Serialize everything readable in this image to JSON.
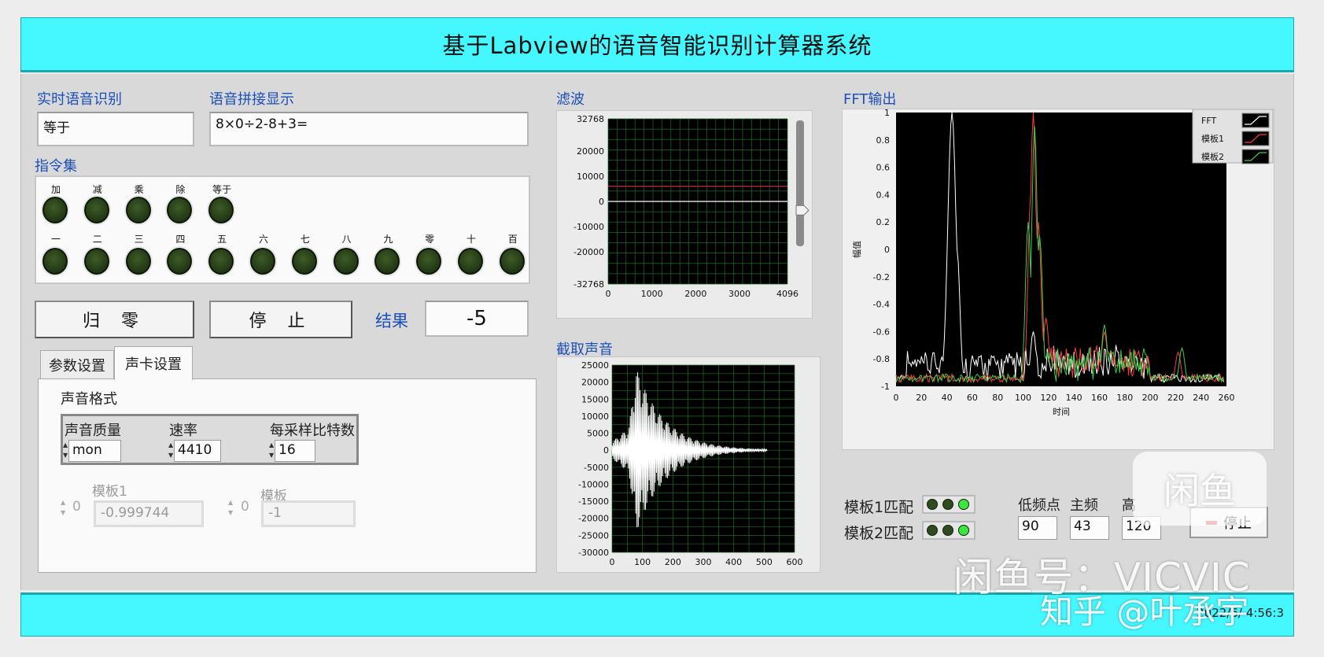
{
  "header": {
    "title": "基于Labview的语音智能识别计算器系统"
  },
  "realtime": {
    "label": "实时语音识别",
    "value": "等于"
  },
  "concat": {
    "label": "语音拼接显示",
    "value": "8×0÷2-8+3="
  },
  "instructions": {
    "label": "指令集",
    "row1": [
      "加",
      "减",
      "乘",
      "除",
      "等于"
    ],
    "row2": [
      "一",
      "二",
      "三",
      "四",
      "五",
      "六",
      "七",
      "八",
      "九",
      "零",
      "十",
      "百"
    ]
  },
  "buttons": {
    "reset": "归 零",
    "stop": "停 止"
  },
  "result": {
    "label": "结果",
    "value": "-5"
  },
  "tabs": [
    "参数设置",
    "声卡设置"
  ],
  "sound_format": {
    "label": "声音格式",
    "columns": [
      "声音质量",
      "速率",
      "每采样比特数"
    ],
    "values": [
      "mon",
      "4410",
      "16"
    ]
  },
  "template1": {
    "label": "模板1",
    "index": "0",
    "value": "-0.999744"
  },
  "template2": {
    "label": "模板",
    "index": "0",
    "value": "-1"
  },
  "filter": {
    "label": "滤波"
  },
  "capture": {
    "label": "截取声音"
  },
  "fft": {
    "label": "FFT输出",
    "legend": [
      "FFT",
      "模板1",
      "模板2"
    ]
  },
  "match": {
    "label1": "模板1匹配",
    "label2": "模板2匹配"
  },
  "freq": {
    "labels": [
      "低频点",
      "主频",
      "高"
    ],
    "values": [
      "90",
      "43",
      "120"
    ]
  },
  "stop_small": "停止",
  "footer": {
    "timestamp": "2022/6/ 4:56:3"
  },
  "watermarks": {
    "xianyu_icon": "闲鱼",
    "xianyu": "闲鱼号：VICVIC",
    "zhihu": "知乎 @叶承宇"
  },
  "colors": {
    "header": "#45f7ff",
    "label_blue": "#1b4fb9",
    "plot_bg": "#000000",
    "grid": "#1f6b2a",
    "fft_line": "#ffffff",
    "template1_line": "#ff3b3b",
    "template2_line": "#3bd04a"
  },
  "chart_data": [
    {
      "type": "line",
      "title": "滤波",
      "xlabel": "",
      "ylabel": "",
      "xlim": [
        0,
        4096
      ],
      "ylim": [
        -32768,
        32768
      ],
      "x_ticks": [
        0,
        1000,
        2000,
        3000,
        4096
      ],
      "y_ticks": [
        32768,
        20000,
        10000,
        0,
        -10000,
        -20000,
        -32768
      ],
      "series": [
        {
          "x": [
            0,
            4096
          ],
          "values": [
            6000,
            6000
          ]
        },
        {
          "x": [
            0,
            4096
          ],
          "values": [
            0,
            0
          ]
        }
      ],
      "slider_value": -3500,
      "grid": true
    },
    {
      "type": "line",
      "title": "截取声音",
      "xlabel": "",
      "ylabel": "",
      "xlim": [
        0,
        600
      ],
      "ylim": [
        -30000,
        25000
      ],
      "x_ticks": [
        0,
        100,
        200,
        300,
        400,
        500,
        600
      ],
      "y_ticks": [
        25000,
        20000,
        15000,
        10000,
        5000,
        0,
        -5000,
        -10000,
        -15000,
        -20000,
        -25000,
        -30000
      ],
      "series": [
        {
          "envelope": {
            "start": 0,
            "peak_x": 80,
            "peak": 24000,
            "trough": -25500,
            "end": 510
          }
        }
      ],
      "grid": true
    },
    {
      "type": "line",
      "title": "FFT输出",
      "xlabel": "时间",
      "ylabel": "幅值",
      "xlim": [
        0,
        260
      ],
      "ylim": [
        -1,
        1
      ],
      "x_ticks": [
        0,
        20,
        40,
        60,
        80,
        100,
        120,
        140,
        160,
        180,
        200,
        220,
        240,
        260
      ],
      "y_ticks": [
        1,
        0.8,
        0.6,
        0.4,
        0.2,
        0,
        -0.2,
        -0.4,
        -0.6,
        -0.8,
        -1
      ],
      "legend": "top-right",
      "series": [
        {
          "name": "FFT",
          "peaks": [
            [
              44,
              1.0
            ],
            [
              48,
              0.0
            ],
            [
              108,
              -0.6
            ],
            [
              120,
              -0.9
            ]
          ]
        },
        {
          "name": "模板1",
          "peaks": [
            [
              106,
              0.4
            ],
            [
              108,
              1.0
            ],
            [
              112,
              0.2
            ],
            [
              118,
              -0.5
            ],
            [
              164,
              -0.6
            ],
            [
              222,
              -0.75
            ]
          ]
        },
        {
          "name": "模板2",
          "peaks": [
            [
              104,
              0.2
            ],
            [
              109,
              0.9
            ],
            [
              113,
              0.1
            ],
            [
              164,
              -0.55
            ],
            [
              225,
              -0.72
            ]
          ]
        }
      ],
      "grid": false
    }
  ]
}
